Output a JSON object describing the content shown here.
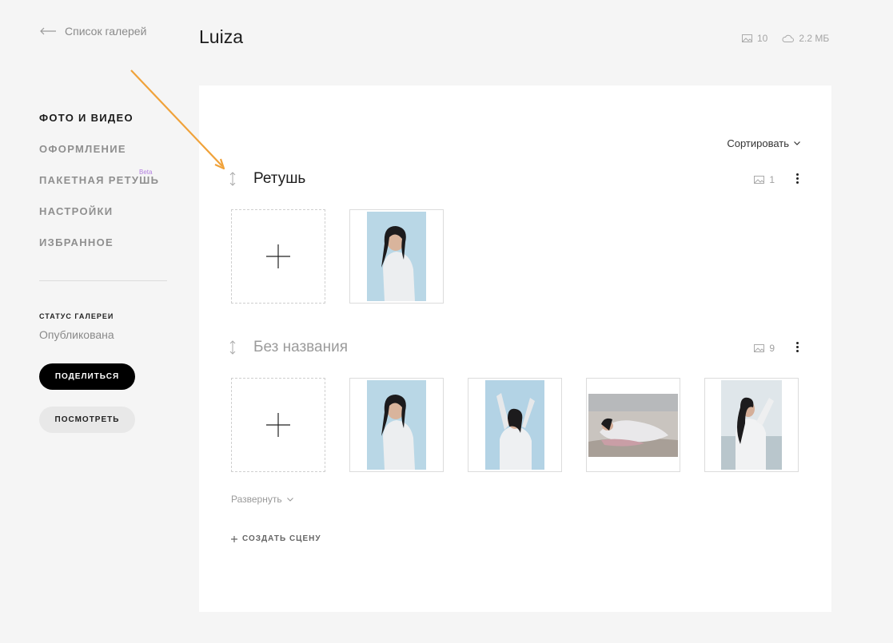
{
  "sidebar": {
    "back_label": "Список галерей",
    "nav": [
      {
        "label": "ФОТО И ВИДЕО",
        "active": true
      },
      {
        "label": "ОФОРМЛЕНИЕ"
      },
      {
        "label": "ПАКЕТНАЯ РЕТУШЬ",
        "badge": "Beta"
      },
      {
        "label": "НАСТРОЙКИ"
      },
      {
        "label": "ИЗБРАННОЕ"
      }
    ],
    "status_title": "СТАТУС ГАЛЕРЕИ",
    "status_value": "Опубликована",
    "share_label": "ПОДЕЛИТЬСЯ",
    "view_label": "ПОСМОТРЕТЬ"
  },
  "header": {
    "title": "Luiza",
    "photo_count": "10",
    "size": "2.2 МБ"
  },
  "main": {
    "sort_label": "Сортировать",
    "scenes": [
      {
        "name": "Ретушь",
        "count": "1"
      },
      {
        "name": "Без названия",
        "count": "9"
      }
    ],
    "expand_label": "Развернуть",
    "create_label": "СОЗДАТЬ СЦЕНУ"
  },
  "colors": {
    "accent_arrow": "#f0a23a",
    "beta_badge": "#b27fe0",
    "sky": "#b9d7e6"
  }
}
